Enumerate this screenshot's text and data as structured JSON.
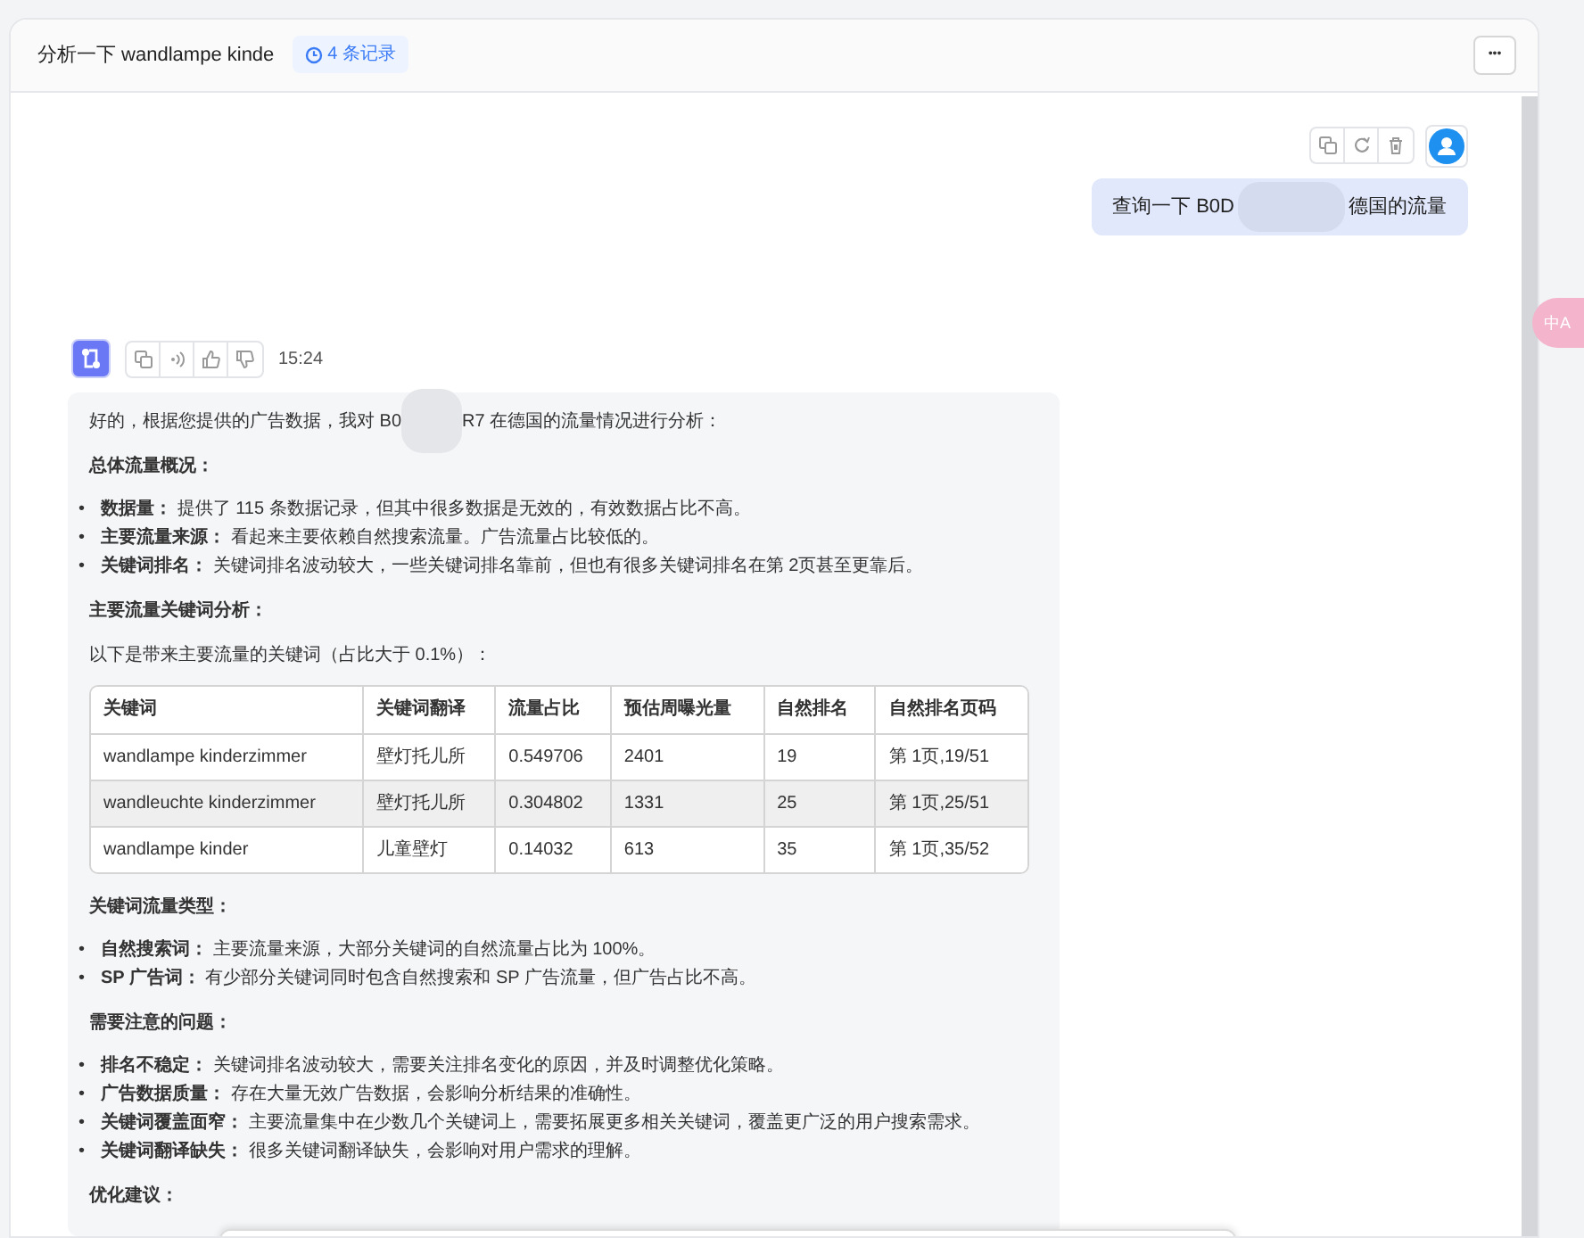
{
  "header": {
    "title": "分析一下 wandlampe kinde",
    "records_badge": "4 条记录",
    "more_button": "•••"
  },
  "user_message": {
    "text_before": "查询一下 B0D",
    "text_after": "德国的流量"
  },
  "assistant_message": {
    "time": "15:24",
    "intro_before": "好的，根据您提供的广告数据，我对 B0",
    "intro_after": "R7 在德国的流量情况进行分析：",
    "blocks": [
      {
        "kind": "heading",
        "text": "总体流量概况："
      },
      {
        "kind": "bullets",
        "marker": "•",
        "items": [
          "**数据量：** 提供了 115 条数据记录，但其中很多数据是无效的，有效数据占比不高。",
          "**主要流量来源：** 看起来主要依赖自然搜索流量。广告流量占比较低的。",
          "**关键词排名：** 关键词排名波动较大，一些关键词排名靠前，但也有很多关键词排名在第 2页甚至更靠后。"
        ]
      },
      {
        "kind": "heading",
        "text": "主要流量关键词分析："
      },
      {
        "kind": "paragraph",
        "text": "以下是带来主要流量的关键词（占比大于 0.1%）："
      },
      {
        "kind": "table",
        "columns": [
          "关键词",
          "关键词翻译",
          "流量占比",
          "预估周曝光量",
          "自然排名",
          "自然排名页码"
        ],
        "rows": [
          {
            "highlighted": false,
            "cells": [
              "wandlampe kinderzimmer",
              "壁灯托儿所",
              "0.549706",
              "2401",
              "19",
              "第 1页,19/51"
            ]
          },
          {
            "highlighted": true,
            "cells": [
              "wandleuchte kinderzimmer",
              "壁灯托儿所",
              "0.304802",
              "1331",
              "25",
              "第 1页,25/51"
            ]
          },
          {
            "highlighted": false,
            "cells": [
              "wandlampe kinder",
              "儿童壁灯",
              "0.14032",
              "613",
              "35",
              "第 1页,35/52"
            ]
          }
        ]
      },
      {
        "kind": "heading",
        "text": "关键词流量类型："
      },
      {
        "kind": "bullets",
        "marker": "•",
        "items": [
          "**自然搜索词：** 主要流量来源，大部分关键词的自然流量占比为 100%。",
          "**SP 广告词：** 有少部分关键词同时包含自然搜索和 SP 广告流量，但广告占比不高。"
        ]
      },
      {
        "kind": "heading",
        "text": "需要注意的问题："
      },
      {
        "kind": "bullets",
        "marker": "•",
        "items": [
          "**排名不稳定：** 关键词排名波动较大，需要关注排名变化的原因，并及时调整优化策略。",
          "**广告数据质量：** 存在大量无效广告数据，会影响分析结果的准确性。",
          "**关键词覆盖面窄：** 主要流量集中在少数几个关键词上，需要拓展更多相关关键词，覆盖更广泛的用户搜索需求。",
          "**关键词翻译缺失：** 很多关键词翻译缺失，会影响对用户需求的理解。"
        ]
      },
      {
        "kind": "heading",
        "text": "优化建议："
      }
    ]
  },
  "translate_button": "中A"
}
